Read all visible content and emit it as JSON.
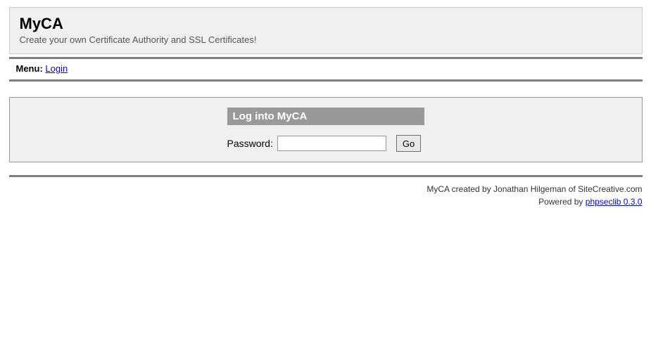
{
  "header": {
    "title": "MyCA",
    "subtitle": "Create your own Certificate Authority and SSL Certificates!"
  },
  "menu": {
    "label": "Menu:",
    "login_link": "Login"
  },
  "login": {
    "panel_title": "Log into MyCA",
    "password_label": "Password:",
    "password_value": "",
    "go_button": "Go"
  },
  "footer": {
    "created_by": "MyCA created by Jonathan Hilgeman of SiteCreative.com",
    "powered_by_prefix": "Powered by ",
    "powered_by_link": "phpseclib 0.3.0"
  }
}
